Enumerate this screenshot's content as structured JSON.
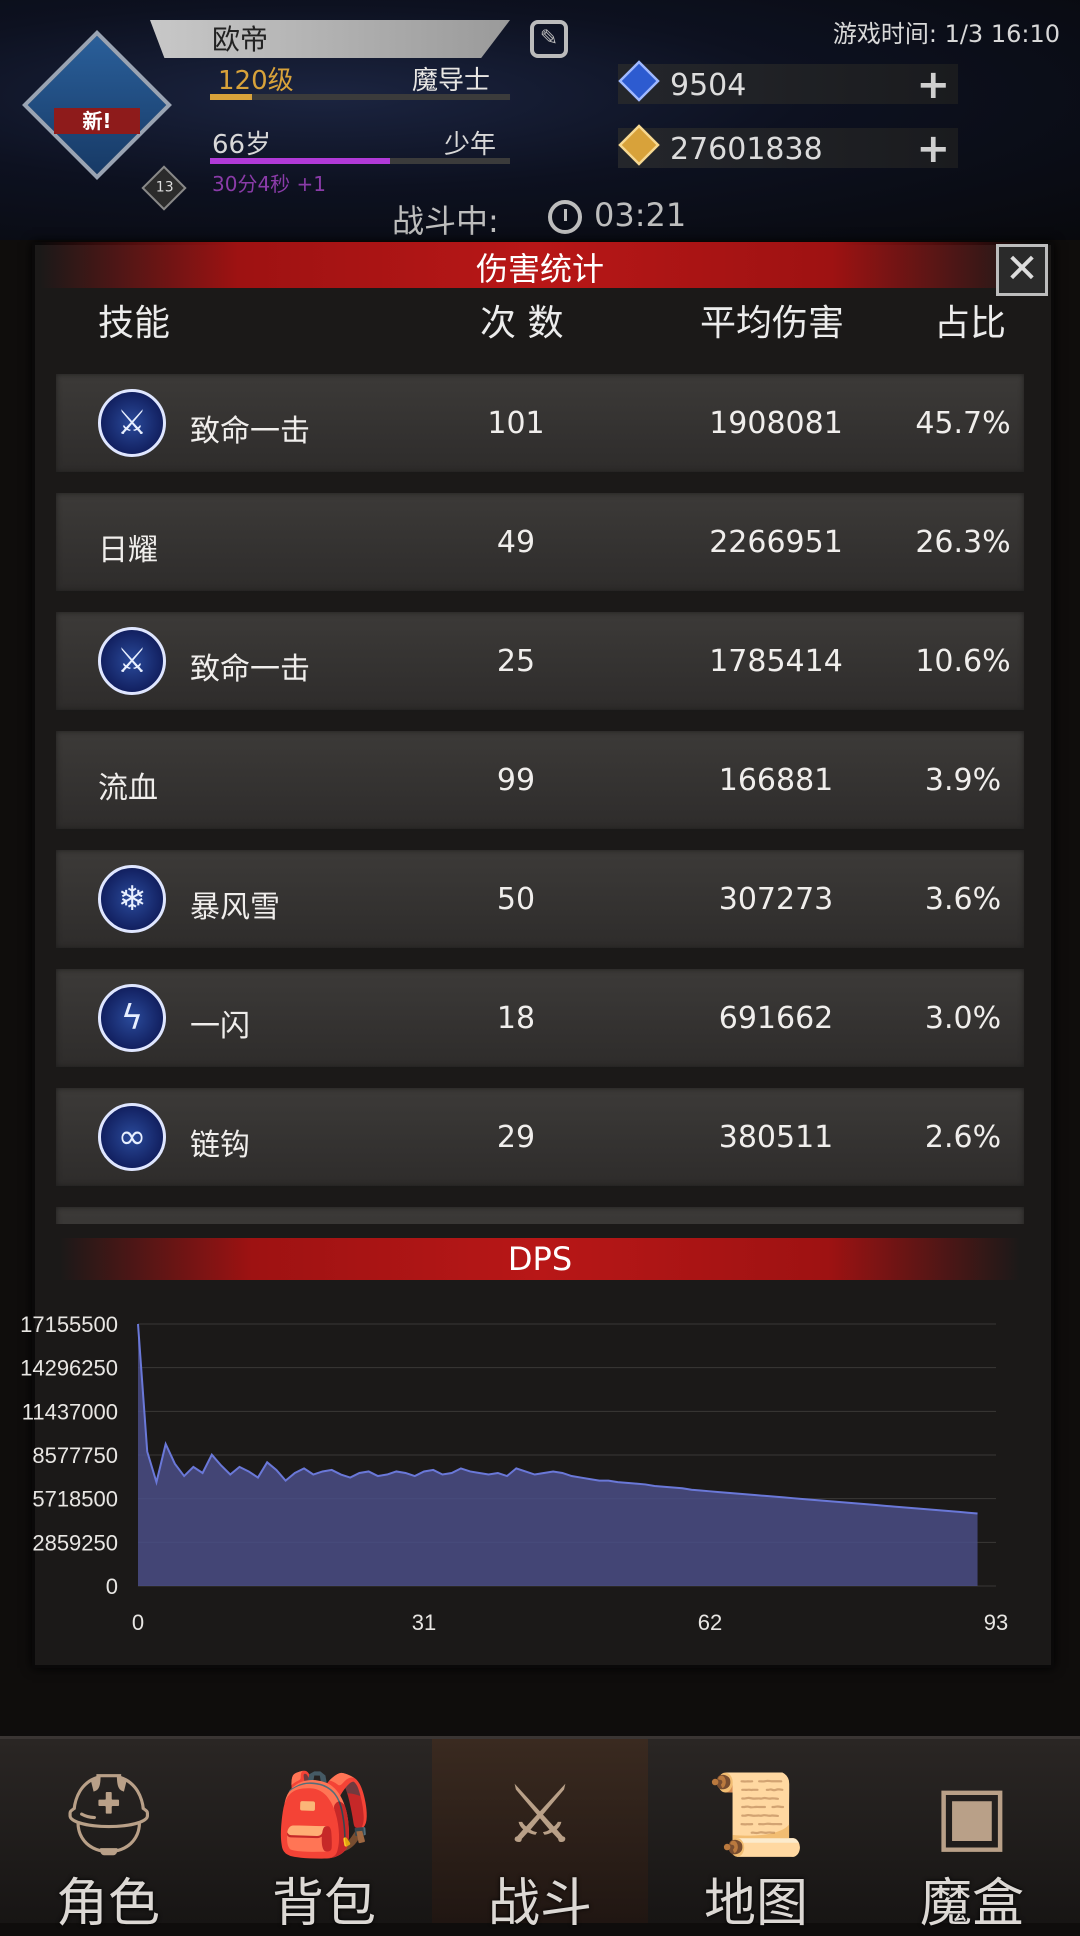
{
  "header": {
    "player_name": "欧帝",
    "level": "120级",
    "class": "魔导士",
    "age": "66岁",
    "age_stage": "少年",
    "timer": "30分4秒 +1",
    "avatar_badge": "新!",
    "avatar_level": "13",
    "game_time": "游戏时间: 1/3 16:10",
    "currencies": [
      {
        "icon": "blue-gem-icon",
        "amount": "9504",
        "color": "#2d5bd0"
      },
      {
        "icon": "gold-gem-icon",
        "amount": "27601838",
        "color": "#d8a23a"
      }
    ],
    "battle_status": "战斗中:",
    "battle_time": "03:21"
  },
  "panel": {
    "title": "伤害统计",
    "columns": {
      "skill": "技能",
      "count": "次 数",
      "avg": "平均伤害",
      "ratio": "占比"
    },
    "rows": [
      {
        "name": "致命一击",
        "icon": "critical-strike-icon",
        "count": "101",
        "avg": "1908081",
        "ratio": "45.7%"
      },
      {
        "name": "日耀",
        "icon": "",
        "count": "49",
        "avg": "2266951",
        "ratio": "26.3%"
      },
      {
        "name": "致命一击",
        "icon": "critical-strike-icon",
        "count": "25",
        "avg": "1785414",
        "ratio": "10.6%"
      },
      {
        "name": "流血",
        "icon": "",
        "count": "99",
        "avg": "166881",
        "ratio": "3.9%"
      },
      {
        "name": "暴风雪",
        "icon": "blizzard-icon",
        "count": "50",
        "avg": "307273",
        "ratio": "3.6%"
      },
      {
        "name": "一闪",
        "icon": "flash-icon",
        "count": "18",
        "avg": "691662",
        "ratio": "3.0%"
      },
      {
        "name": "链钩",
        "icon": "chain-hook-icon",
        "count": "29",
        "avg": "380511",
        "ratio": "2.6%"
      }
    ]
  },
  "chart_data": {
    "type": "area",
    "title": "DPS",
    "xlabel": "",
    "ylabel": "",
    "x_ticks": [
      "0",
      "31",
      "62",
      "93"
    ],
    "y_ticks": [
      "17155500",
      "14296250",
      "11437000",
      "8577750",
      "5718500",
      "2859250",
      "0"
    ],
    "xlim": [
      0,
      93
    ],
    "ylim": [
      0,
      17155500
    ],
    "grid": true,
    "fill_color": "#4a4e86",
    "line_color": "#6a78d8",
    "series": [
      {
        "values": [
          17155500,
          8800000,
          6800000,
          9300000,
          8000000,
          7200000,
          7800000,
          7400000,
          8600000,
          7900000,
          7300000,
          7800000,
          7500000,
          7100000,
          8100000,
          7600000,
          6900000,
          7400000,
          7700000,
          7300000,
          7500000,
          7600000,
          7300000,
          7100000,
          7400000,
          7500000,
          7200000,
          7300000,
          7500000,
          7400000,
          7200000,
          7500000,
          7600000,
          7300000,
          7400000,
          7700000,
          7500000,
          7400000,
          7300000,
          7400000,
          7200000,
          7700000,
          7500000,
          7300000,
          7400000,
          7500000,
          7400000,
          7200000,
          7100000,
          7000000,
          6900000,
          6900000,
          6800000,
          6750000,
          6700000,
          6650000,
          6550000,
          6500000,
          6450000,
          6400000,
          6300000,
          6250000,
          6200000,
          6150000,
          6100000,
          6050000,
          6000000,
          5950000,
          5900000,
          5850000,
          5800000,
          5750000,
          5700000,
          5650000,
          5600000,
          5550000,
          5500000,
          5450000,
          5400000,
          5350000,
          5300000,
          5250000,
          5200000,
          5150000,
          5100000,
          5050000,
          5000000,
          4950000,
          4900000,
          4850000,
          4800000,
          4750000
        ]
      }
    ]
  },
  "nav": [
    {
      "label": "角色",
      "icon": "helmet-icon"
    },
    {
      "label": "背包",
      "icon": "backpack-icon"
    },
    {
      "label": "战斗",
      "icon": "sword-shield-icon",
      "active": true
    },
    {
      "label": "地图",
      "icon": "map-scroll-icon"
    },
    {
      "label": "魔盒",
      "icon": "magic-box-icon"
    }
  ]
}
